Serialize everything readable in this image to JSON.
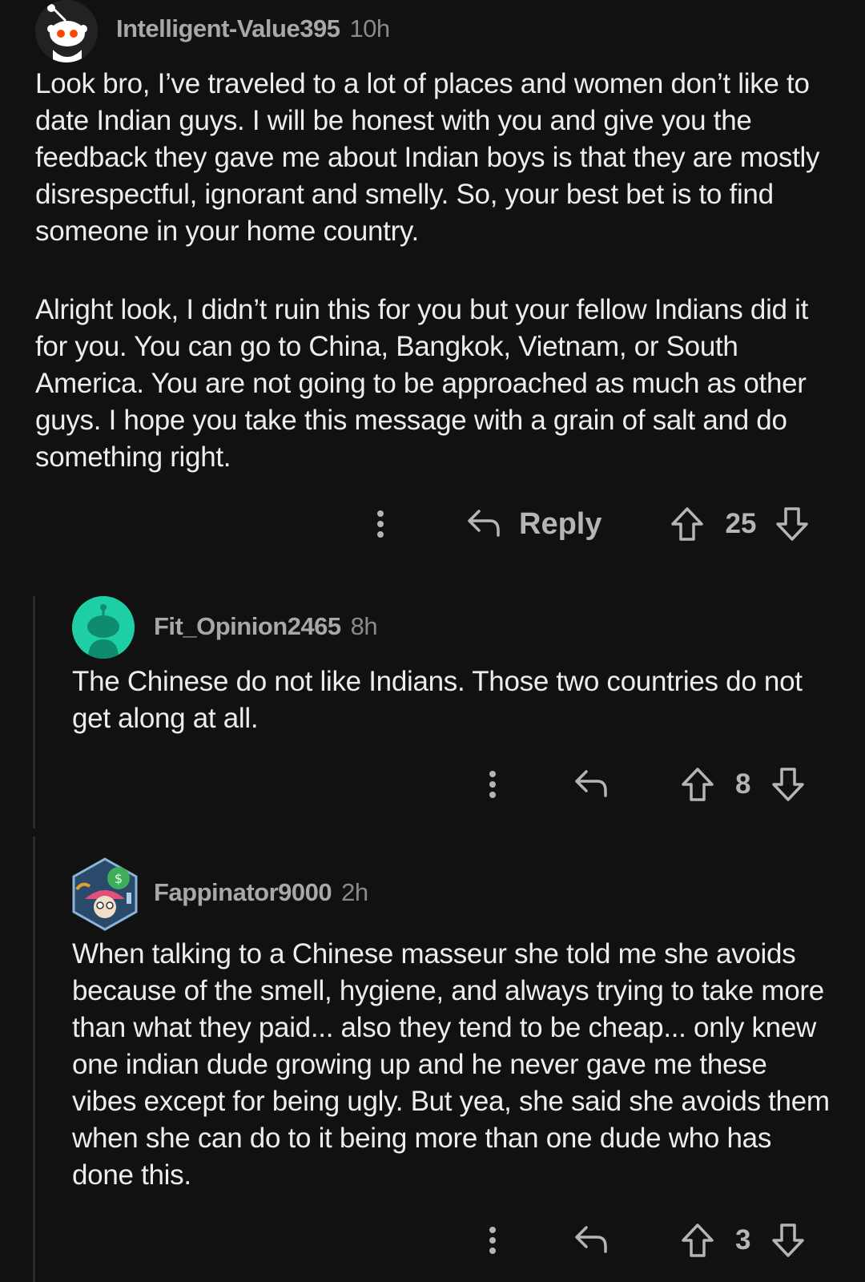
{
  "comments": [
    {
      "username": "Intelligent-Value395",
      "time": "10h",
      "paragraphs": [
        "Look bro, I’ve traveled to a lot of places and women don’t like to date Indian guys. I will be honest with you and give you the feedback they gave me about Indian boys is that they are mostly disrespectful, ignorant and smelly. So, your best bet is to find someone in your home country.",
        "Alright look, I didn’t ruin this for you but your fellow Indians did it for you. You can go to China, Bangkok, Vietnam, or South America. You are not going to be approached as much as other guys. I hope you take this message with a grain of salt and do something right."
      ],
      "reply_label": "Reply",
      "score": "25",
      "avatar_icon": "snoo-avatar-icon"
    },
    {
      "username": "Fit_Opinion2465",
      "time": "8h",
      "paragraphs": [
        "The Chinese do not like Indians. Those two countries do not get along at all."
      ],
      "score": "8",
      "avatar_icon": "snoo-teal-avatar-icon"
    },
    {
      "username": "Fappinator9000",
      "time": "2h",
      "paragraphs": [
        "When talking to a Chinese masseur she told me she avoids because of the smell, hygiene, and always trying to take more than what they paid... also they tend to be cheap... only knew one indian dude growing up and he never gave me these vibes except for being ugly. But yea, she said she avoids them when she can do to it being more than one dude who has done this."
      ],
      "score": "3",
      "avatar_icon": "custom-avatar-icon"
    }
  ],
  "colors": {
    "background": "#111111",
    "text": "#ededed",
    "muted": "#a8a8a8",
    "thread_line": "#2b2b2b",
    "teal_avatar": "#1ecfa5"
  }
}
